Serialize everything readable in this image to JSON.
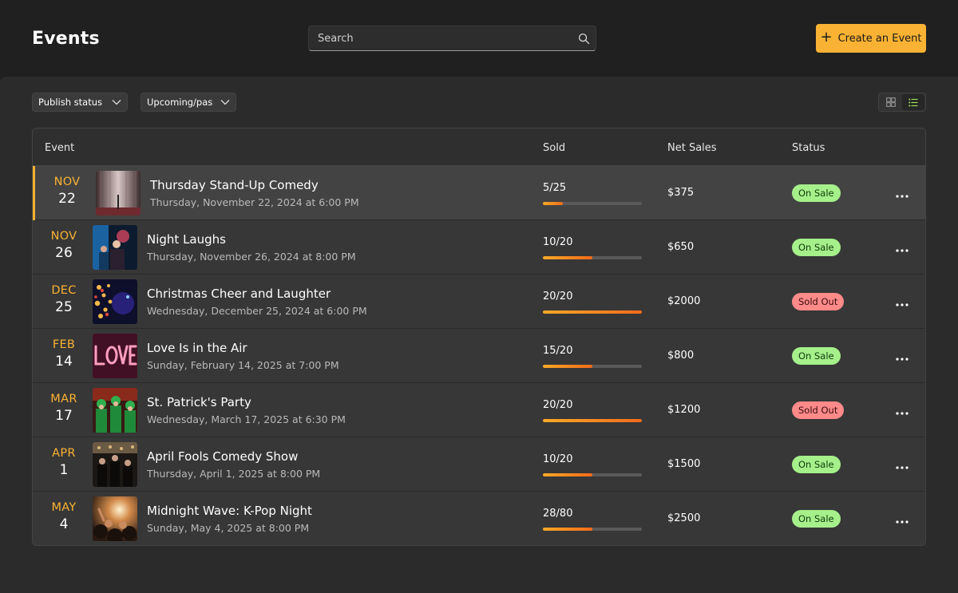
{
  "header": {
    "title": "Events",
    "search_placeholder": "Search",
    "create_label": "Create an Event"
  },
  "filters": {
    "publish_status": "Publish status",
    "upcoming_past": "Upcoming/pas"
  },
  "view_toggle": {
    "active": "list",
    "options": [
      "grid",
      "list"
    ]
  },
  "columns": {
    "event": "Event",
    "sold": "Sold",
    "net_sales": "Net Sales",
    "status": "Status"
  },
  "colors": {
    "accent": "#f9b233",
    "on_sale": "#a5f08a",
    "sold_out": "#ff8a8a"
  },
  "events": [
    {
      "month": "NOV",
      "day": "22",
      "title": "Thursday Stand-Up Comedy",
      "datetime": "Thursday, November 22, 2024 at 6:00 PM",
      "sold": "5/25",
      "sold_fraction": 0.2,
      "net": "$375",
      "status": "On Sale",
      "status_kind": "on",
      "thumb": "curtain-stage"
    },
    {
      "month": "NOV",
      "day": "26",
      "title": "Night Laughs",
      "datetime": "Thursday, November 26, 2024 at 8:00 PM",
      "sold": "10/20",
      "sold_fraction": 0.5,
      "net": "$650",
      "status": "On Sale",
      "status_kind": "on",
      "thumb": "neon-crowd"
    },
    {
      "month": "DEC",
      "day": "25",
      "title": "Christmas Cheer and Laughter",
      "datetime": "Wednesday, December 25, 2024 at 6:00 PM",
      "sold": "20/20",
      "sold_fraction": 1.0,
      "net": "$2000",
      "status": "Sold Out",
      "status_kind": "off",
      "thumb": "christmas-lights"
    },
    {
      "month": "FEB",
      "day": "14",
      "title": "Love Is in the Air",
      "datetime": "Sunday, February 14, 2025 at 7:00 PM",
      "sold": "15/20",
      "sold_fraction": 0.5,
      "net": "$800",
      "status": "On Sale",
      "status_kind": "on",
      "thumb": "love-neon"
    },
    {
      "month": "MAR",
      "day": "17",
      "title": "St. Patrick's Party",
      "datetime": "Wednesday, March 17, 2025 at 6:30 PM",
      "sold": "20/20",
      "sold_fraction": 1.0,
      "net": "$1200",
      "status": "Sold Out",
      "status_kind": "off",
      "thumb": "green-party"
    },
    {
      "month": "APR",
      "day": "1",
      "title": "April Fools Comedy Show",
      "datetime": "Thursday, April 1, 2025 at 8:00 PM",
      "sold": "10/20",
      "sold_fraction": 0.5,
      "net": "$1500",
      "status": "On Sale",
      "status_kind": "on",
      "thumb": "bar-crowd"
    },
    {
      "month": "MAY",
      "day": "4",
      "title": "Midnight Wave: K-Pop Night",
      "datetime": "Sunday, May 4, 2025 at 8:00 PM",
      "sold": "28/80",
      "sold_fraction": 0.5,
      "net": "$2500",
      "status": "On Sale",
      "status_kind": "on",
      "thumb": "concert-lights"
    }
  ]
}
